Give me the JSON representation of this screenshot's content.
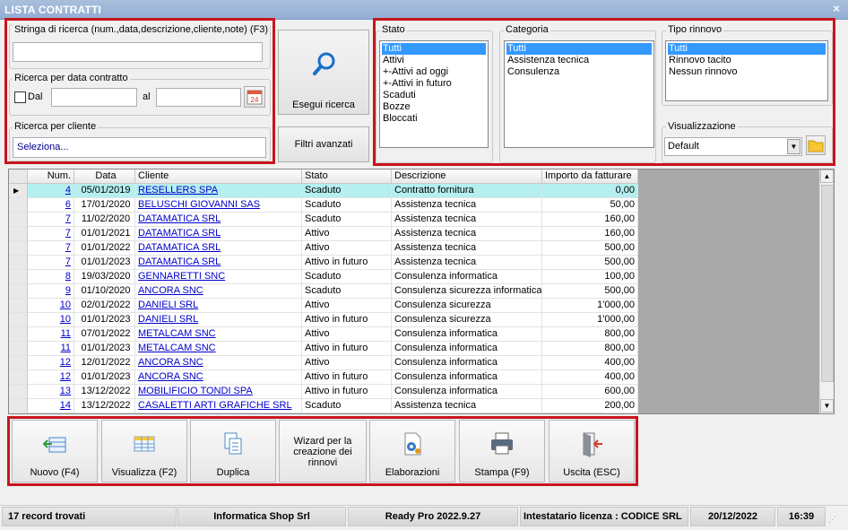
{
  "window": {
    "title": "LISTA CONTRATTI",
    "close_label": "×"
  },
  "search": {
    "string_label": "Stringa di ricerca (num.,data,descrizione,cliente,note) (F3)",
    "string_value": "",
    "date_group_label": "Ricerca per data contratto",
    "dal_label": "Dal",
    "al_label": "al",
    "dal_value": "",
    "al_value": "",
    "client_group_label": "Ricerca per cliente",
    "client_placeholder": "Seleziona...",
    "esegui_label": "Esegui ricerca",
    "filtri_label": "Filtri avanzati",
    "calendar_day": "24"
  },
  "filters": {
    "stato": {
      "label": "Stato",
      "items": [
        "Tutti",
        "Attivi",
        "+-Attivi ad oggi",
        "+-Attivi in futuro",
        "Scaduti",
        "Bozze",
        "Bloccati"
      ],
      "selected": 0
    },
    "categoria": {
      "label": "Categoria",
      "items": [
        "Tutti",
        "Assistenza tecnica",
        "Consulenza"
      ],
      "selected": 0
    },
    "rinnovo": {
      "label": "Tipo rinnovo",
      "items": [
        "Tutti",
        "Rinnovo tacito",
        "Nessun rinnovo"
      ],
      "selected": 0
    },
    "visualizzazione": {
      "label": "Visualizzazione",
      "value": "Default"
    }
  },
  "grid": {
    "columns": [
      "Num.",
      "Data",
      "Cliente",
      "Stato",
      "Descrizione",
      "Importo da fatturare"
    ],
    "rows": [
      {
        "num": "4",
        "data": "05/01/2019",
        "cliente": "RESELLERS SPA",
        "stato": "Scaduto",
        "descrizione": "Contratto fornitura",
        "importo": "0,00",
        "current": true
      },
      {
        "num": "6",
        "data": "17/01/2020",
        "cliente": "BELUSCHI GIOVANNI SAS",
        "stato": "Scaduto",
        "descrizione": "Assistenza tecnica",
        "importo": "50,00"
      },
      {
        "num": "7",
        "data": "11/02/2020",
        "cliente": "DATAMATICA SRL",
        "stato": "Scaduto",
        "descrizione": "Assistenza tecnica",
        "importo": "160,00"
      },
      {
        "num": "7",
        "data": "01/01/2021",
        "cliente": "DATAMATICA SRL",
        "stato": "Attivo",
        "descrizione": "Assistenza tecnica",
        "importo": "160,00"
      },
      {
        "num": "7",
        "data": "01/01/2022",
        "cliente": "DATAMATICA SRL",
        "stato": "Attivo",
        "descrizione": "Assistenza tecnica",
        "importo": "500,00"
      },
      {
        "num": "7",
        "data": "01/01/2023",
        "cliente": "DATAMATICA SRL",
        "stato": "Attivo in futuro",
        "descrizione": "Assistenza tecnica",
        "importo": "500,00"
      },
      {
        "num": "8",
        "data": "19/03/2020",
        "cliente": "GENNARETTI SNC",
        "stato": "Scaduto",
        "descrizione": "Consulenza informatica",
        "importo": "100,00"
      },
      {
        "num": "9",
        "data": "01/10/2020",
        "cliente": "ANCORA SNC",
        "stato": "Scaduto",
        "descrizione": "Consulenza sicurezza informatica",
        "importo": "500,00"
      },
      {
        "num": "10",
        "data": "02/01/2022",
        "cliente": "DANIELI SRL",
        "stato": "Attivo",
        "descrizione": "Consulenza sicurezza",
        "importo": "1'000,00"
      },
      {
        "num": "10",
        "data": "01/01/2023",
        "cliente": "DANIELI SRL",
        "stato": "Attivo in futuro",
        "descrizione": "Consulenza sicurezza",
        "importo": "1'000,00"
      },
      {
        "num": "11",
        "data": "07/01/2022",
        "cliente": "METALCAM SNC",
        "stato": "Attivo",
        "descrizione": "Consulenza informatica",
        "importo": "800,00"
      },
      {
        "num": "11",
        "data": "01/01/2023",
        "cliente": "METALCAM SNC",
        "stato": "Attivo in futuro",
        "descrizione": "Consulenza informatica",
        "importo": "800,00"
      },
      {
        "num": "12",
        "data": "12/01/2022",
        "cliente": "ANCORA SNC",
        "stato": "Attivo",
        "descrizione": "Consulenza informatica",
        "importo": "400,00"
      },
      {
        "num": "12",
        "data": "01/01/2023",
        "cliente": "ANCORA SNC",
        "stato": "Attivo in futuro",
        "descrizione": "Consulenza informatica",
        "importo": "400,00"
      },
      {
        "num": "13",
        "data": "13/12/2022",
        "cliente": "MOBILIFICIO TONDI SPA",
        "stato": "Attivo in futuro",
        "descrizione": "Consulenza informatica",
        "importo": "600,00"
      },
      {
        "num": "14",
        "data": "13/12/2022",
        "cliente": "CASALETTI ARTI GRAFICHE SRL",
        "stato": "Scaduto",
        "descrizione": "Assistenza tecnica",
        "importo": "200,00"
      }
    ]
  },
  "actions": [
    {
      "label": "Nuovo (F4)",
      "icon": "new-record-icon"
    },
    {
      "label": "Visualizza (F2)",
      "icon": "view-table-icon"
    },
    {
      "label": "Duplica",
      "icon": "duplicate-icon"
    },
    {
      "label": "Wizard per la creazione dei rinnovi",
      "icon": ""
    },
    {
      "label": "Elaborazioni",
      "icon": "process-gear-icon"
    },
    {
      "label": "Stampa (F9)",
      "icon": "printer-icon"
    },
    {
      "label": "Uscita (ESC)",
      "icon": "exit-door-icon"
    }
  ],
  "status": {
    "records": "17 record trovati",
    "company": "Informatica Shop Srl",
    "version": "Ready Pro 2022.9.27",
    "license": "Intestatario licenza : CODICE SRL",
    "date": "20/12/2022",
    "time": "16:39"
  },
  "colors": {
    "title_bar": "#9bb4d7",
    "highlight_red": "#c8141c",
    "selection": "#3399ff",
    "current_row": "#b5efef",
    "link": "#0000cc"
  }
}
